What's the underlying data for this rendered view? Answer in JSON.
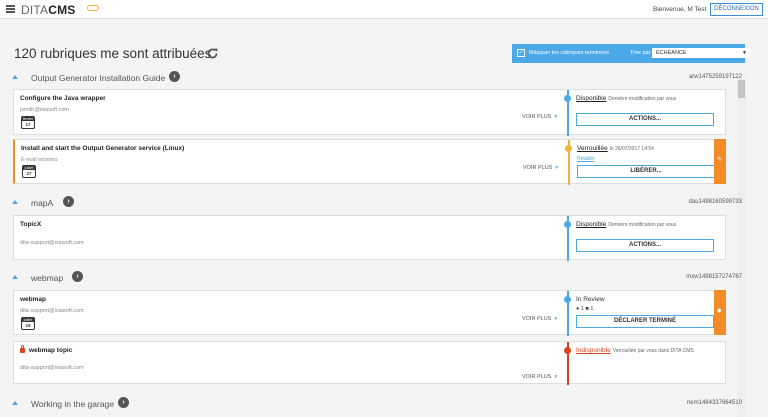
{
  "header": {
    "logo_part1": "DITA",
    "logo_part2": "CMS",
    "welcome": "Bienvenue, M Test",
    "logout_label": "DÉCONNEXION"
  },
  "page": {
    "title": "120 rubriques me sont attribuées"
  },
  "filter": {
    "hide_done_label": "Masquer les rubriques terminées",
    "sort_label": "Trier par :",
    "sort_value": "ÉCHÉANCE"
  },
  "groups": [
    {
      "name": "Output Generator Installation Guide",
      "id": "arw1475259197122",
      "cards": [
        {
          "title": "Configure the Java wrapper",
          "email": "jsmith@ixiasoft.com",
          "cal_month": "février",
          "cal_day": "17",
          "voir_plus": "VOIR PLUS",
          "status": "Disponible",
          "status_sub": "Dernière modification par vous",
          "action": "ACTIONS..."
        },
        {
          "title": "Install and start the Output Generator service (Linux)",
          "email": "E-mail inconnu",
          "cal_month": "juillet",
          "cal_day": "27",
          "voir_plus": "VOIR PLUS",
          "status": "Verrouillée",
          "status_sub": "le 26/07/2017 14:54",
          "link": "Rétablir",
          "action": "LIBÉRER..."
        }
      ]
    },
    {
      "name": "mapA",
      "id": "dau1498160599733",
      "cards": [
        {
          "title": "TopicX",
          "email": "dita-support@ixiasoft.com",
          "voir_plus": "VOIR PLUS",
          "status": "Disponible",
          "status_sub": "Dernière modification par vous",
          "action": "ACTIONS..."
        }
      ]
    },
    {
      "name": "webmap",
      "id": "mxw1498157274767",
      "cards": [
        {
          "title": "webmap",
          "email": "dita-support@ixiasoft.com",
          "cal_month": "juillet",
          "cal_day": "19",
          "voir_plus": "VOIR PLUS",
          "status": "In Review",
          "icons_text": "1",
          "icons_text2": "1",
          "action": "DÉCLARER TERMINÉ"
        },
        {
          "title": "webmap topic",
          "email": "dita-support@ixiasoft.com",
          "voir_plus": "VOIR PLUS",
          "status": "Indisponible",
          "status_sub": "Verrouillée par vous dans DITA CMS"
        }
      ]
    },
    {
      "name": "Working in the garage",
      "id": "nem1484337664510"
    }
  ],
  "colors": {
    "accent_blue": "#4aa9e6",
    "accent_orange": "#f28c28",
    "unavailable_red": "#d9431e"
  }
}
